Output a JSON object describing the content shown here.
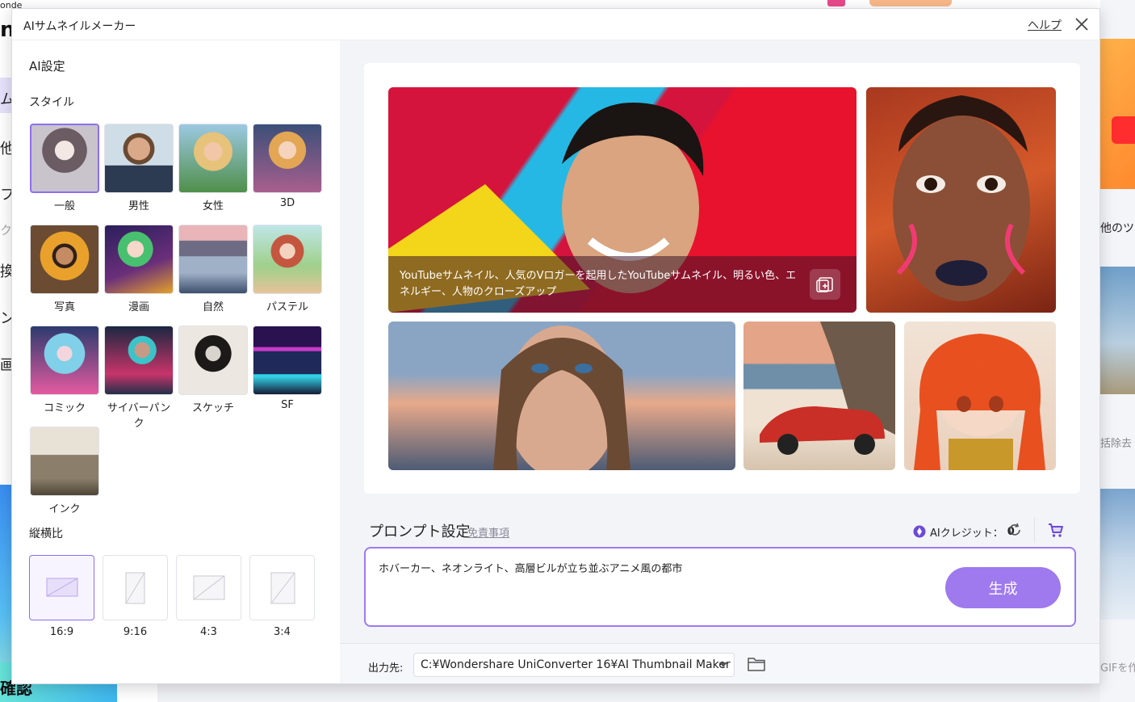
{
  "background": {
    "left_texts": [
      "ム",
      "他",
      "フ",
      "ク",
      "換",
      "ン",
      "画"
    ],
    "top_left_small": "onde",
    "top_left_big": "n",
    "bottom_left_text": "確認",
    "right_texts": [
      "他のツー",
      "括除去",
      "GIFを作"
    ]
  },
  "dialog": {
    "title": "AIサムネイルメーカー",
    "help_label": "ヘルプ"
  },
  "left_panel": {
    "ai_settings_label": "AI設定",
    "style_label": "スタイル",
    "styles": [
      {
        "label": "一般",
        "selected": true
      },
      {
        "label": "男性",
        "selected": false
      },
      {
        "label": "女性",
        "selected": false
      },
      {
        "label": "3D",
        "selected": false
      },
      {
        "label": "写真",
        "selected": false
      },
      {
        "label": "漫画",
        "selected": false
      },
      {
        "label": "自然",
        "selected": false
      },
      {
        "label": "パステル",
        "selected": false
      },
      {
        "label": "コミック",
        "selected": false
      },
      {
        "label": "サイバーパンク",
        "selected": false
      },
      {
        "label": "スケッチ",
        "selected": false
      },
      {
        "label": "SF",
        "selected": false
      },
      {
        "label": "インク",
        "selected": false
      }
    ],
    "aspect_label": "縦横比",
    "aspect_ratios": [
      {
        "label": "16:9",
        "selected": true
      },
      {
        "label": "9:16",
        "selected": false
      },
      {
        "label": "4:3",
        "selected": false
      },
      {
        "label": "3:4",
        "selected": false
      }
    ]
  },
  "gallery": {
    "caption": "YouTubeサムネイル、人気のVロガーを起用したYouTubeサムネイル、明るい色、エネルギー、人物のクローズアップ"
  },
  "prompt": {
    "title": "プロンプト設定",
    "disclaimer_label": "免責事項",
    "credit_label": "AIクレジット：",
    "credit_value": "0",
    "text": "ホバーカー、ネオンライト、高層ビルが立ち並ぶアニメ風の都市",
    "generate_label": "生成"
  },
  "output": {
    "label": "出力先:",
    "path": "C:¥Wondershare UniConverter 16¥AI Thumbnail Maker"
  },
  "colors": {
    "accent": "#9f79ee",
    "selected_border": "#8b6ff0"
  }
}
